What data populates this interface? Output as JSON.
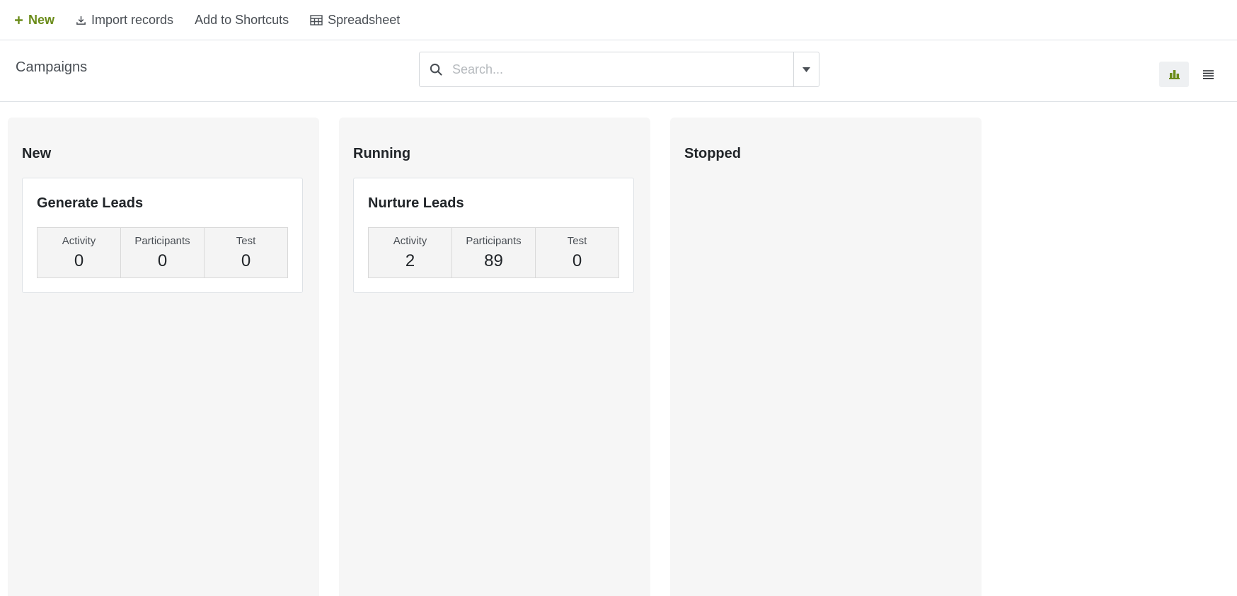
{
  "toolbar": {
    "new_label": "New",
    "import_label": "Import records",
    "shortcuts_label": "Add to Shortcuts",
    "spreadsheet_label": "Spreadsheet"
  },
  "header": {
    "title": "Campaigns",
    "search_placeholder": "Search..."
  },
  "colors": {
    "accent": "#6b8c1a",
    "column_bg": "#f6f6f6"
  },
  "columns": [
    {
      "title": "New",
      "cards": [
        {
          "title": "Generate Leads",
          "stats": [
            {
              "label": "Activity",
              "value": "0"
            },
            {
              "label": "Participants",
              "value": "0"
            },
            {
              "label": "Test",
              "value": "0"
            }
          ]
        }
      ]
    },
    {
      "title": "Running",
      "cards": [
        {
          "title": "Nurture Leads",
          "stats": [
            {
              "label": "Activity",
              "value": "2"
            },
            {
              "label": "Participants",
              "value": "89"
            },
            {
              "label": "Test",
              "value": "0"
            }
          ]
        }
      ]
    },
    {
      "title": "Stopped",
      "cards": []
    }
  ]
}
